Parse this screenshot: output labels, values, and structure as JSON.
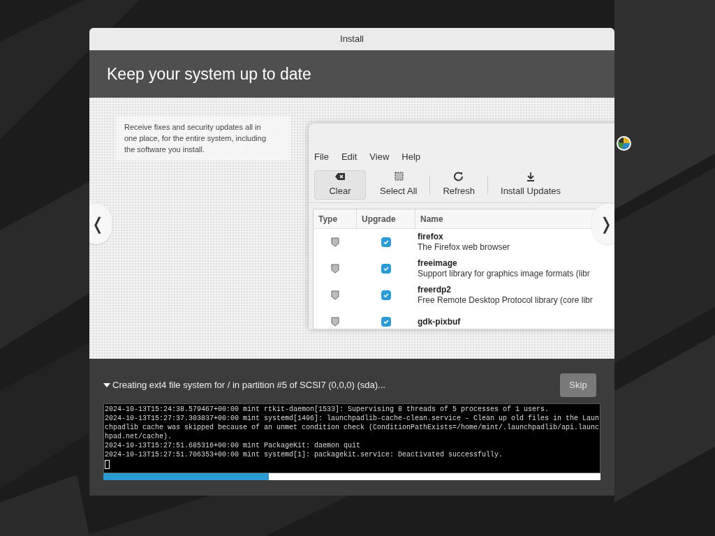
{
  "window": {
    "title": "Install"
  },
  "header": {
    "title": "Keep your system up to date"
  },
  "slide": {
    "description": "Receive fixes and security updates all in one place, for the entire system, including the software you install.",
    "app": {
      "menu": [
        "File",
        "Edit",
        "View",
        "Help"
      ],
      "toolbar": [
        {
          "label": "Clear",
          "kind": "clear"
        },
        {
          "label": "Select All",
          "kind": "select"
        },
        {
          "label": "Refresh",
          "kind": "refresh"
        },
        {
          "label": "Install Updates",
          "kind": "download"
        }
      ],
      "columns": [
        "Type",
        "Upgrade",
        "Name"
      ],
      "rows": [
        {
          "name": "firefox",
          "description": "The Firefox web browser",
          "checked": true
        },
        {
          "name": "freeimage",
          "description": "Support library for graphics image formats (libr",
          "checked": true
        },
        {
          "name": "freerdp2",
          "description": "Free Remote Desktop Protocol library (core libr",
          "checked": true
        },
        {
          "name": "gdk-pixbuf",
          "checked": true
        }
      ]
    },
    "prev": "❬",
    "next": "❭"
  },
  "progress": {
    "status": "Creating ext4 file system for / in partition #5 of SCSI7 (0,0,0) (sda)...",
    "expanded": true,
    "skip": {
      "label": "Skip",
      "disabled": true
    },
    "log": [
      "2024-10-13T15:24:38.579467+00:00 mint rtkit-daemon[1533]: Supervising 8 threads of 5 processes of 1 users.",
      "2024-10-13T15:27:37.303837+00:00 mint systemd[1496]: launchpadlib-cache-clean.service - Clean up old files in the Laun",
      "chpadlib cache was skipped because of an unmet condition check (ConditionPathExists=/home/mint/.launchpadlib/api.launc",
      "hpad.net/cache).",
      "2024-10-13T15:27:51.685316+00:00 mint PackageKit: daemon quit",
      "2024-10-13T15:27:51.706353+00:00 mint systemd[1]: packagekit.service: Deactivated successfully."
    ],
    "level": 0.333
  }
}
